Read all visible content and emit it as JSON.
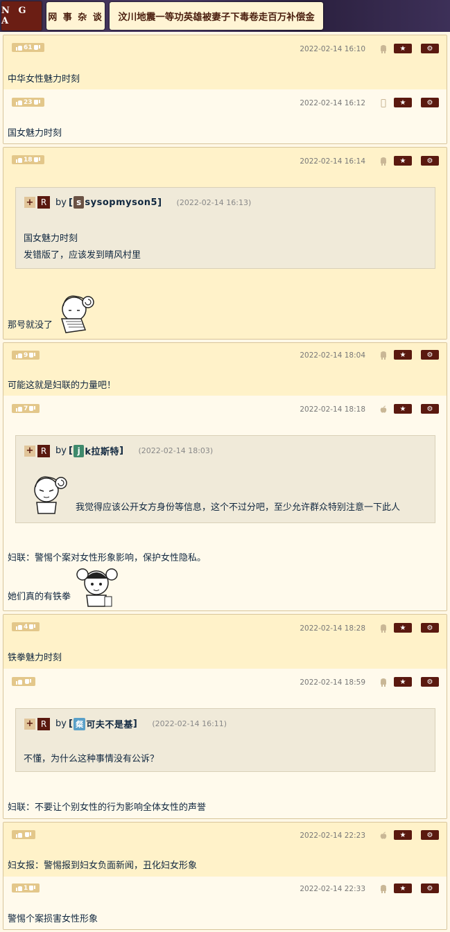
{
  "header": {
    "logo": "N G A",
    "forum": "网 事 杂 谈",
    "thread_title": "汶川地震一等功英雄被妻子下毒卷走百万补偿金"
  },
  "icons": {
    "star": "★",
    "gear": "⚙",
    "android": "android-icon",
    "apple": "apple-icon",
    "phone": "phone-icon"
  },
  "posts": [
    {
      "votes": "61",
      "date": "2022-02-14 16:10",
      "device": "android",
      "text": "中华女性魅力时刻"
    },
    {
      "votes": "23",
      "date": "2022-02-14 16:12",
      "device": "phone",
      "text": "国女魅力时刻"
    },
    {
      "votes": "18",
      "date": "2022-02-14 16:14",
      "device": "android",
      "quote": {
        "user": "sysopmyson5",
        "avatar_letter": "s",
        "time": "(2022-02-14 16:13)",
        "lines": [
          "国女魅力时刻",
          "发错版了，应该发到晴风村里"
        ]
      },
      "text": "那号就没了"
    },
    {
      "votes": "9",
      "date": "2022-02-14 18:04",
      "device": "android",
      "text": "可能这就是妇联的力量吧！"
    },
    {
      "votes": "7",
      "date": "2022-02-14 18:18",
      "device": "apple",
      "quote": {
        "user": "k拉斯特",
        "avatar_letter": "j",
        "time": "(2022-02-14 18:03)",
        "lines": [
          "我觉得应该公开女方身份等信息，这个不过分吧，至少允许群众特别注意一下此人"
        ]
      },
      "text": "妇联：警惕个案对女性形象影响，保护女性隐私。",
      "text2": "她们真的有铁拳"
    },
    {
      "votes": "4",
      "date": "2022-02-14 18:28",
      "device": "android",
      "text": "铁拳魅力时刻"
    },
    {
      "votes": "",
      "date": "2022-02-14 18:59",
      "device": "android",
      "quote": {
        "user": "可夫不是基",
        "avatar_letter": "粲",
        "time": "(2022-02-14 16:11)",
        "lines": [
          "不懂，为什么这种事情没有公诉？"
        ]
      },
      "text": "妇联：不要让个别女性的行为影响全体女性的声誉"
    },
    {
      "votes": "",
      "date": "2022-02-14 22:23",
      "device": "apple",
      "text": "妇女报：警惕报到妇女负面新闻，丑化妇女形象"
    },
    {
      "votes": "1",
      "date": "2022-02-14 22:33",
      "device": "android",
      "text": "警惕个案损害女性形象"
    }
  ],
  "quote_labels": {
    "plus": "+",
    "reply": "R",
    "by": "by",
    "open": "[",
    "close": "]"
  },
  "colors": {
    "accent": "#5a190f",
    "vote_bg": "#e3c78a",
    "row_a": "#fff2c9",
    "row_b": "#fffaec"
  }
}
